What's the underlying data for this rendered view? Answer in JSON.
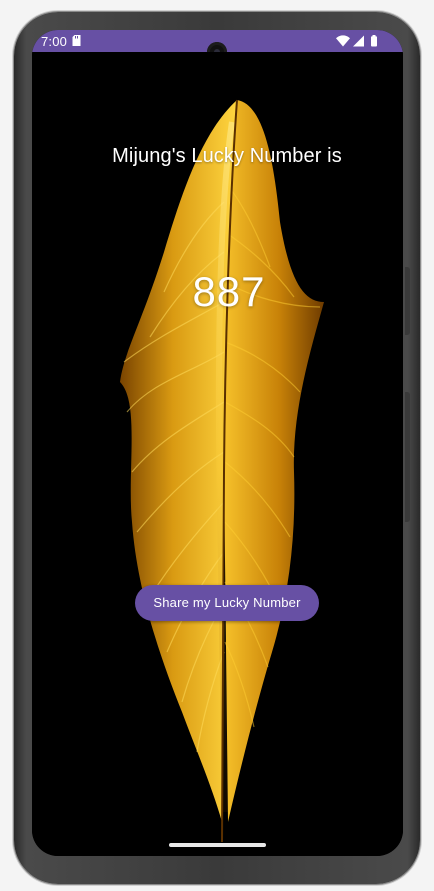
{
  "status_bar": {
    "time": "7:00",
    "icons": [
      "sd-card-icon",
      "wifi-icon",
      "cellular-signal-icon",
      "battery-icon"
    ],
    "background": "#6750a4"
  },
  "app": {
    "title_text": "Mijung's Lucky Number is",
    "lucky_number": "887",
    "share_button_label": "Share my Lucky Number",
    "accent_color": "#6750a4",
    "background_image": "golden-feather"
  }
}
